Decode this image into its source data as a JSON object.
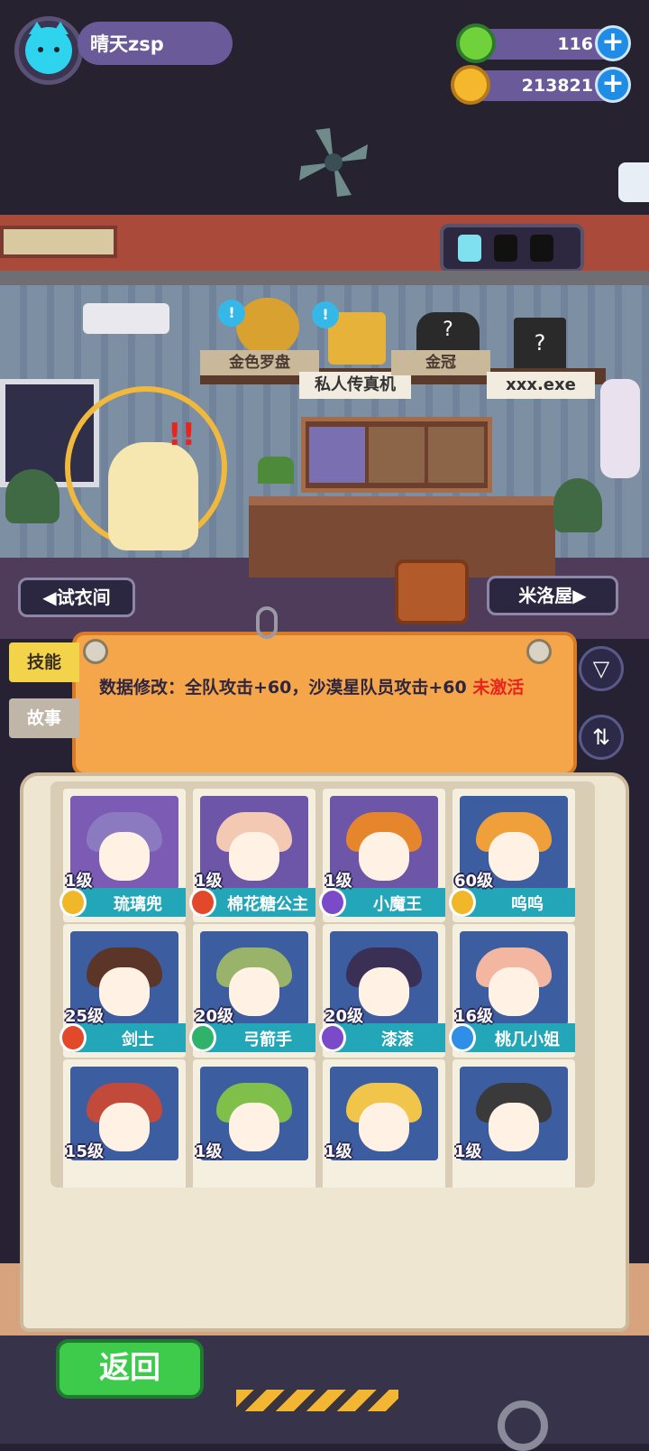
{
  "player": {
    "name": "晴天zsp",
    "avatar_icon": "cat-icon"
  },
  "currencies": [
    {
      "icon": "green-gem-icon",
      "value": "116",
      "color": "#6fd23a"
    },
    {
      "icon": "gold-planet-coin-icon",
      "value": "213821",
      "color": "#f5b72b"
    }
  ],
  "room": {
    "items": [
      "金色罗盘",
      "私人传真机",
      "金冠",
      "xxx.exe"
    ],
    "left_nav": "试衣间",
    "right_nav": "米洛屋"
  },
  "tabs": [
    "技能",
    "故事"
  ],
  "skill": {
    "text": "数据修改：全队攻击+60，沙漠星队员攻击+60",
    "status": "未激活"
  },
  "characters": [
    {
      "level": "1级",
      "name": "琉璃兜",
      "bg": "#7b5bb4",
      "hair": "#8c7ac0",
      "badge": "#f0b829"
    },
    {
      "level": "1级",
      "name": "棉花糖公主",
      "bg": "#6d55a8",
      "hair": "#f3c9b3",
      "badge": "#e2492a"
    },
    {
      "level": "1级",
      "name": "小魔王",
      "bg": "#6d55a8",
      "hair": "#e6862c",
      "badge": "#7a4ac8"
    },
    {
      "level": "60级",
      "name": "呜呜",
      "bg": "#3c5da0",
      "hair": "#f0a03a",
      "badge": "#f0b829"
    },
    {
      "level": "25级",
      "name": "剑士",
      "bg": "#3c5da0",
      "hair": "#5a3528",
      "badge": "#e2492a"
    },
    {
      "level": "20级",
      "name": "弓箭手",
      "bg": "#3c5da0",
      "hair": "#9ab36a",
      "badge": "#2fb36a"
    },
    {
      "level": "20级",
      "name": "漆漆",
      "bg": "#3c5da0",
      "hair": "#3a2f55",
      "badge": "#7a4ac8"
    },
    {
      "level": "16级",
      "name": "桃几小姐",
      "bg": "#3c5da0",
      "hair": "#f3b6a0",
      "badge": "#2f8ee6"
    },
    {
      "level": "15级",
      "name": "",
      "bg": "#3c5da0",
      "hair": "#c24a3a",
      "badge": ""
    },
    {
      "level": "1级",
      "name": "",
      "bg": "#3c5da0",
      "hair": "#7fbf4a",
      "badge": ""
    },
    {
      "level": "1级",
      "name": "",
      "bg": "#3c5da0",
      "hair": "#f1c44a",
      "badge": ""
    },
    {
      "level": "1级",
      "name": "",
      "bg": "#3c5da0",
      "hair": "#3a3a3a",
      "badge": ""
    }
  ],
  "back_button": "返回",
  "icons": {
    "filter": "filter-icon",
    "sort": "sort-icon",
    "share": "share-icon",
    "gallery": "gallery-icon"
  }
}
